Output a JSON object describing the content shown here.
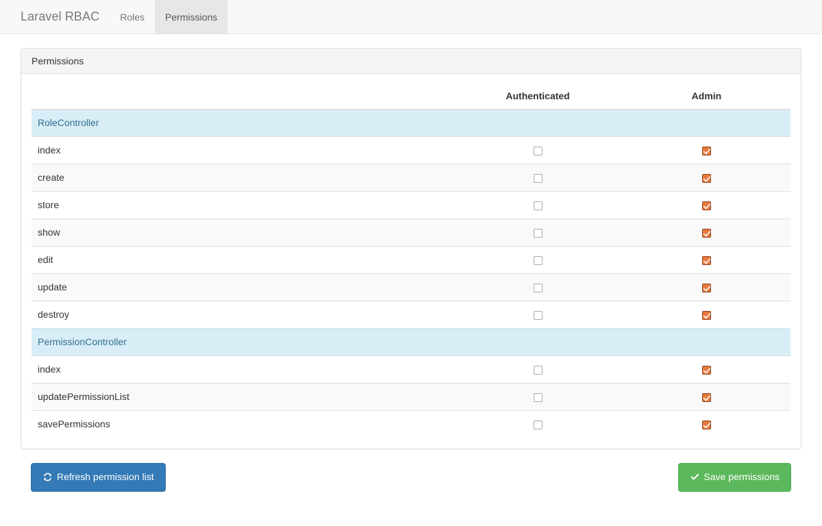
{
  "navbar": {
    "brand": "Laravel RBAC",
    "links": [
      {
        "label": "Roles",
        "active": false
      },
      {
        "label": "Permissions",
        "active": true
      }
    ]
  },
  "panel": {
    "heading": "Permissions",
    "table": {
      "headers": {
        "name": "",
        "roles": [
          "Authenticated",
          "Admin"
        ]
      },
      "groups": [
        {
          "name": "RoleController",
          "rows": [
            {
              "name": "index",
              "authenticated": false,
              "admin": true
            },
            {
              "name": "create",
              "authenticated": false,
              "admin": true
            },
            {
              "name": "store",
              "authenticated": false,
              "admin": true
            },
            {
              "name": "show",
              "authenticated": false,
              "admin": true
            },
            {
              "name": "edit",
              "authenticated": false,
              "admin": true
            },
            {
              "name": "update",
              "authenticated": false,
              "admin": true
            },
            {
              "name": "destroy",
              "authenticated": false,
              "admin": true
            }
          ]
        },
        {
          "name": "PermissionController",
          "rows": [
            {
              "name": "index",
              "authenticated": false,
              "admin": true
            },
            {
              "name": "updatePermissionList",
              "authenticated": false,
              "admin": true
            },
            {
              "name": "savePermissions",
              "authenticated": false,
              "admin": true
            }
          ]
        }
      ]
    }
  },
  "footer": {
    "refresh_button": {
      "label": "Refresh permission list",
      "icon": "refresh-icon"
    },
    "save_button": {
      "label": "Save permissions",
      "icon": "check-icon"
    }
  },
  "colors": {
    "navbar_bg": "#f8f8f8",
    "navbar_active_bg": "#e7e7e7",
    "panel_heading_bg": "#f5f5f5",
    "group_row_bg": "#d9edf7",
    "group_row_text": "#31708f",
    "stripe_bg": "#f9f9f9",
    "checkbox_checked": "#e8783c",
    "btn_primary": "#337ab7",
    "btn_success": "#5cb85c"
  }
}
